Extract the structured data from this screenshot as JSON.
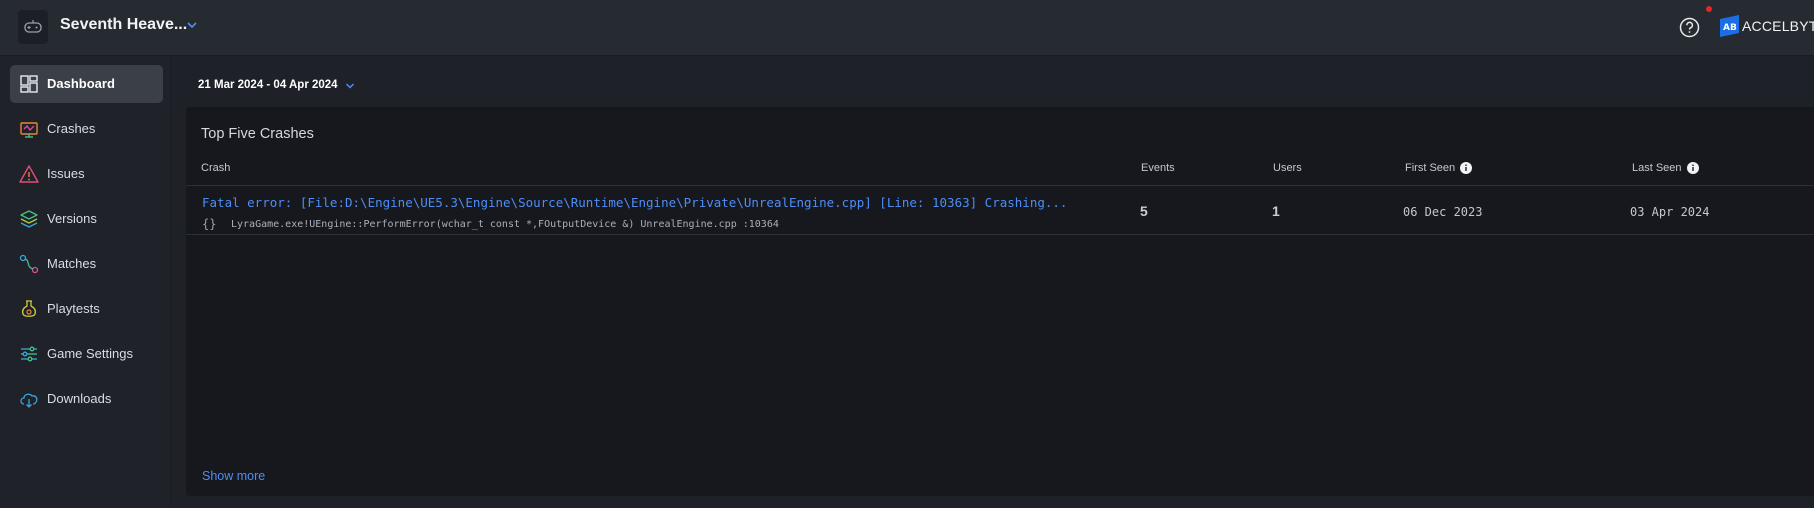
{
  "header": {
    "game_name": "Seventh Heave...",
    "brand_name": "ACCELBYTE"
  },
  "sidebar": {
    "items": [
      {
        "label": "Dashboard",
        "icon": "dashboard-icon",
        "active": true
      },
      {
        "label": "Crashes",
        "icon": "crashes-icon"
      },
      {
        "label": "Issues",
        "icon": "warning-icon"
      },
      {
        "label": "Versions",
        "icon": "layers-icon"
      },
      {
        "label": "Matches",
        "icon": "matches-icon"
      },
      {
        "label": "Playtests",
        "icon": "flask-icon"
      },
      {
        "label": "Game Settings",
        "icon": "sliders-icon"
      },
      {
        "label": "Downloads",
        "icon": "cloud-download-icon"
      }
    ]
  },
  "filters": {
    "date_range": "21 Mar 2024 - 04 Apr 2024"
  },
  "panel": {
    "title": "Top Five Crashes",
    "columns": {
      "crash": "Crash",
      "events": "Events",
      "users": "Users",
      "first_seen": "First Seen",
      "last_seen": "Last Seen"
    },
    "rows": [
      {
        "title": "Fatal error: [File:D:\\Engine\\UE5.3\\Engine\\Source\\Runtime\\Engine\\Private\\UnrealEngine.cpp] [Line: 10363] Crashing...",
        "brace": "{}",
        "frame": "LyraGame.exe!UEngine::PerformError(wchar_t const *,FOutputDevice &) UnrealEngine.cpp :10364",
        "events": "5",
        "users": "1",
        "first_seen": "06 Dec 2023",
        "last_seen": "03 Apr 2024"
      }
    ],
    "show_more": "Show more"
  },
  "colors": {
    "accent": "#4e8df5",
    "notification": "#e3262b",
    "brand": "#1a6fe6"
  }
}
